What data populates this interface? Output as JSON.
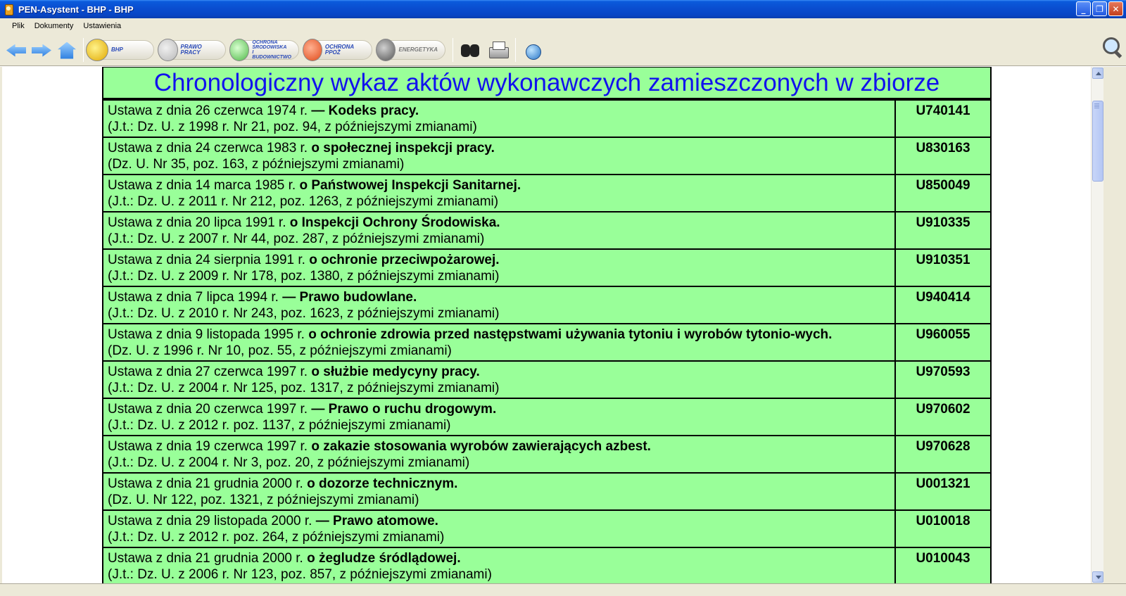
{
  "window": {
    "title": "PEN-Asystent - BHP - BHP",
    "minimize_glyph": "_",
    "maximize_glyph": "❐",
    "close_glyph": "✕"
  },
  "menu": {
    "items": [
      "Plik",
      "Dokumenty",
      "Ustawienia"
    ]
  },
  "toolbar": {
    "back_icon": "arrow-left-icon",
    "forward_icon": "arrow-right-icon",
    "home_icon": "home-icon",
    "modules": [
      {
        "label": "BHP",
        "icon": "bhp-worker-icon",
        "color": "#f0c020"
      },
      {
        "label": "PRAWO PRACY",
        "icon": "labour-law-icon",
        "color": "#d33b2a"
      },
      {
        "label": "OCHRONA ŚRODOWISKA I BUDOWNICTWO",
        "label_lines": [
          "OCHRONA",
          "ŚRODOWISKA",
          "I BUDOWNICTWO"
        ],
        "icon": "environment-icon",
        "color": "#4fb848"
      },
      {
        "label": "OCHRONA PPOŻ",
        "icon": "fire-truck-icon",
        "color": "#e04a1a"
      },
      {
        "label": "ENERGETYKA",
        "icon": "energy-icon",
        "color": "#555555"
      }
    ],
    "search_icon": "binoculars-icon",
    "print_icon": "printer-icon",
    "globe_icon": "globe-icon",
    "zoom_icon": "magnifier-icon"
  },
  "page": {
    "title": "Chronologiczny wykaz aktów wykonawczych zamieszczonych w zbiorze",
    "title_color": "#1111ee",
    "background_color": "#99ff99",
    "acts": [
      {
        "prefix": "Ustawa z dnia 26 czerwca 1974 r. ",
        "name": "— Kodeks pracy.",
        "source": "(J.t.: Dz. U. z 1998 r. Nr 21, poz. 94, z późniejszymi zmianami)",
        "code": "U740141"
      },
      {
        "prefix": "Ustawa z dnia 24 czerwca 1983 r. ",
        "name": "o społecznej inspekcji pracy.",
        "source": "(Dz. U. Nr 35, poz. 163, z późniejszymi zmianami)",
        "code": "U830163"
      },
      {
        "prefix": "Ustawa z dnia 14 marca 1985 r. ",
        "name": "o Państwowej Inspekcji Sanitarnej.",
        "source": "(J.t.: Dz. U. z 2011 r. Nr 212, poz. 1263, z późniejszymi zmianami)",
        "code": "U850049"
      },
      {
        "prefix": "Ustawa z dnia 20 lipca 1991 r. ",
        "name": "o Inspekcji Ochrony Środowiska.",
        "source": "(J.t.: Dz. U. z 2007 r. Nr 44, poz. 287, z późniejszymi zmianami)",
        "code": "U910335"
      },
      {
        "prefix": "Ustawa z dnia 24 sierpnia 1991 r. ",
        "name": "o ochronie przeciwpożarowej.",
        "source": "(J.t.: Dz. U. z 2009 r. Nr 178, poz. 1380, z późniejszymi zmianami)",
        "code": "U910351"
      },
      {
        "prefix": "Ustawa z dnia 7 lipca 1994 r. ",
        "name": "— Prawo budowlane.",
        "source": "(J.t.: Dz. U. z 2010 r. Nr 243, poz. 1623, z późniejszymi zmianami)",
        "code": "U940414"
      },
      {
        "prefix": "Ustawa z dnia 9 listopada 1995 r. ",
        "name": "o ochronie zdrowia przed następstwami używania tytoniu i wyrobów tytonio-wych.",
        "source": "(Dz. U. z 1996 r. Nr 10, poz. 55, z późniejszymi zmianami)",
        "code": "U960055"
      },
      {
        "prefix": "Ustawa z dnia 27 czerwca 1997 r. ",
        "name": "o służbie medycyny pracy.",
        "source": "(J.t.: Dz. U. z 2004 r. Nr 125, poz. 1317, z późniejszymi zmianami)",
        "code": "U970593"
      },
      {
        "prefix": "Ustawa z dnia 20 czerwca 1997 r. ",
        "name": "— Prawo o ruchu drogowym.",
        "source": "(J.t.: Dz. U. z 2012 r. poz. 1137, z późniejszymi zmianami)",
        "code": "U970602"
      },
      {
        "prefix": "Ustawa z dnia 19 czerwca 1997 r. ",
        "name": "o zakazie stosowania wyrobów zawierających azbest.",
        "source": "(J.t.: Dz. U. z 2004 r. Nr 3, poz. 20, z późniejszymi zmianami)",
        "code": "U970628"
      },
      {
        "prefix": "Ustawa z dnia 21 grudnia 2000 r. ",
        "name": "o dozorze technicznym.",
        "source": "(Dz. U. Nr 122, poz. 1321, z późniejszymi zmianami)",
        "code": "U001321"
      },
      {
        "prefix": "Ustawa z dnia 29 listopada 2000 r. ",
        "name": "— Prawo atomowe.",
        "source": "(J.t.: Dz. U. z 2012 r. poz. 264, z późniejszymi zmianami)",
        "code": "U010018"
      },
      {
        "prefix": "Ustawa z dnia 21 grudnia 2000 r. ",
        "name": "o żegludze śródlądowej.",
        "source": "(J.t.: Dz. U. z 2006 r. Nr 123, poz. 857, z późniejszymi zmianami)",
        "code": "U010043"
      }
    ]
  }
}
